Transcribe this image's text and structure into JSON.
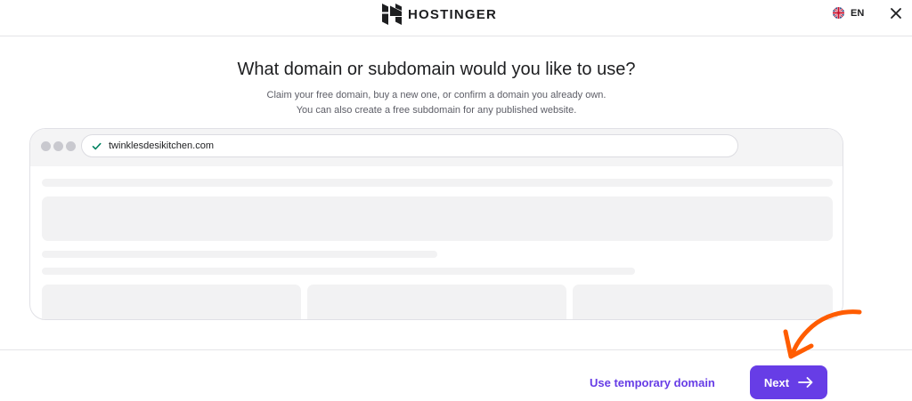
{
  "header": {
    "brand": "HOSTINGER",
    "language": "EN"
  },
  "main": {
    "title": "What domain or subdomain would you like to use?",
    "subtitle": "Claim your free domain, buy a new one, or confirm a domain you already own. You can also create a free subdomain for any published website."
  },
  "preview": {
    "url": "twinklesdesikitchen.com"
  },
  "footer": {
    "temporary_domain_label": "Use temporary domain",
    "next_label": "Next"
  },
  "colors": {
    "accent": "#673de6",
    "annotation": "#ff5c00"
  },
  "icons": [
    "hostinger-logo-icon",
    "uk-flag-icon",
    "close-icon",
    "check-icon",
    "arrow-right-icon",
    "annotation-arrow-icon"
  ]
}
